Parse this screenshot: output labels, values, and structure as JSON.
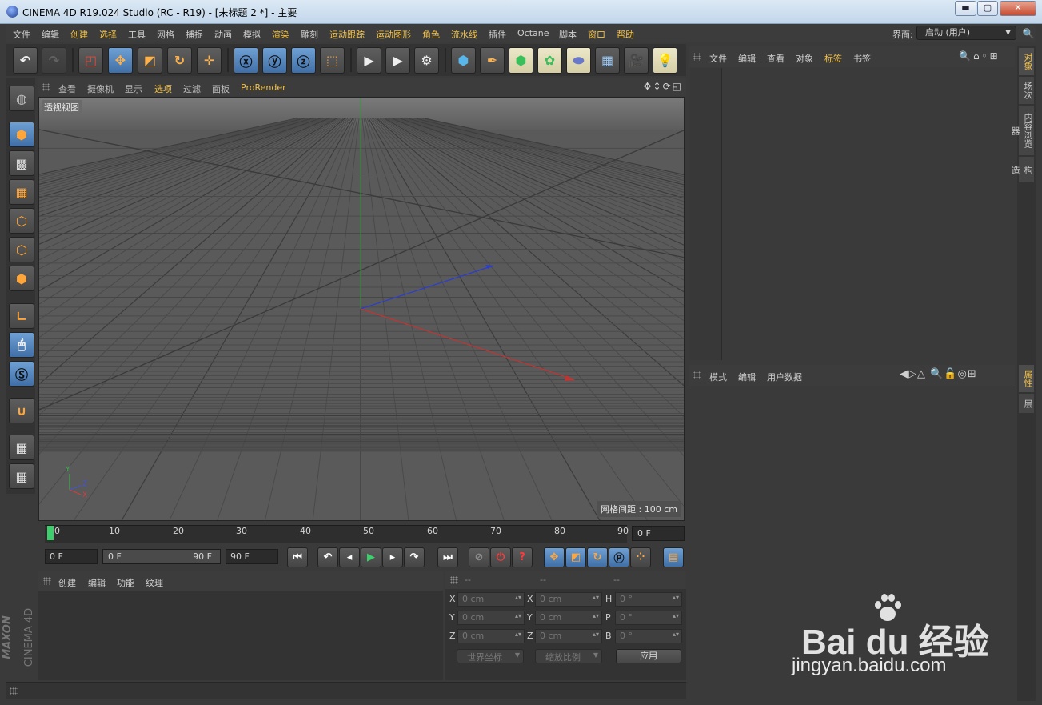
{
  "window": {
    "title": "CINEMA 4D R19.024 Studio (RC - R19) - [未标题 2 *] - 主要",
    "minimize": "▬",
    "maximize": "▢",
    "close": "✕"
  },
  "menubar": {
    "items": [
      {
        "label": "文件",
        "highlight": false
      },
      {
        "label": "编辑",
        "highlight": false
      },
      {
        "label": "创建",
        "highlight": true
      },
      {
        "label": "选择",
        "highlight": true
      },
      {
        "label": "工具",
        "highlight": false
      },
      {
        "label": "网格",
        "highlight": false
      },
      {
        "label": "捕捉",
        "highlight": false
      },
      {
        "label": "动画",
        "highlight": false
      },
      {
        "label": "模拟",
        "highlight": false
      },
      {
        "label": "渲染",
        "highlight": true
      },
      {
        "label": "雕刻",
        "highlight": false
      },
      {
        "label": "运动跟踪",
        "highlight": true
      },
      {
        "label": "运动图形",
        "highlight": true
      },
      {
        "label": "角色",
        "highlight": true
      },
      {
        "label": "流水线",
        "highlight": true
      },
      {
        "label": "插件",
        "highlight": false
      },
      {
        "label": "Octane",
        "highlight": false
      },
      {
        "label": "脚本",
        "highlight": false
      },
      {
        "label": "窗口",
        "highlight": true
      },
      {
        "label": "帮助",
        "highlight": true
      }
    ],
    "layout_label": "界面:",
    "layout_value": "启动 (用户)"
  },
  "viewport": {
    "menu": [
      "查看",
      "摄像机",
      "显示",
      "选项",
      "过滤",
      "面板",
      "ProRender"
    ],
    "active_menu": "选项",
    "view_name": "透视视图",
    "grid_spacing": "网格间距 : 100 cm",
    "axis_labels": {
      "x": "X",
      "y": "Y",
      "z": "Z"
    }
  },
  "timeline": {
    "ticks": [
      "0",
      "10",
      "20",
      "30",
      "40",
      "50",
      "60",
      "70",
      "80",
      "90"
    ],
    "current_frame": "0 F",
    "start_field": "0 F",
    "range_start": "0 F",
    "range_end": "90 F",
    "end_field": "90 F"
  },
  "material_manager": {
    "menu": [
      "创建",
      "编辑",
      "功能",
      "纹理"
    ]
  },
  "coordinates": {
    "headers": [
      "--",
      "--",
      "--"
    ],
    "rows": [
      {
        "l1": "X",
        "v1": "0 cm",
        "l2": "X",
        "v2": "0 cm",
        "l3": "H",
        "v3": "0 °"
      },
      {
        "l1": "Y",
        "v1": "0 cm",
        "l2": "Y",
        "v2": "0 cm",
        "l3": "P",
        "v3": "0 °"
      },
      {
        "l1": "Z",
        "v1": "0 cm",
        "l2": "Z",
        "v2": "0 cm",
        "l3": "B",
        "v3": "0 °"
      }
    ],
    "world_dropdown": "世界坐标",
    "scale_dropdown": "缩放比例",
    "apply": "应用"
  },
  "object_manager": {
    "menu": [
      "文件",
      "编辑",
      "查看",
      "对象",
      "标签",
      "书签"
    ],
    "active_menu": "标签"
  },
  "attribute_manager": {
    "menu": [
      "模式",
      "编辑",
      "用户数据"
    ]
  },
  "side_tabs": {
    "top": [
      "对象",
      "场次",
      "内容浏览器",
      "构造"
    ],
    "bottom": [
      "属性",
      "层"
    ]
  },
  "branding": {
    "maxon": "MAXON",
    "cinema": "CINEMA 4D"
  },
  "watermark": {
    "logo": "Bai du 经验",
    "url": "jingyan.baidu.com"
  },
  "colors": {
    "accent": "#f2c24a",
    "selected_tool": "#4f80b8",
    "x_axis": "#c0393b",
    "y_axis": "#3fa34d",
    "z_axis": "#3b4fc4",
    "playhead": "#3ccf6c"
  }
}
